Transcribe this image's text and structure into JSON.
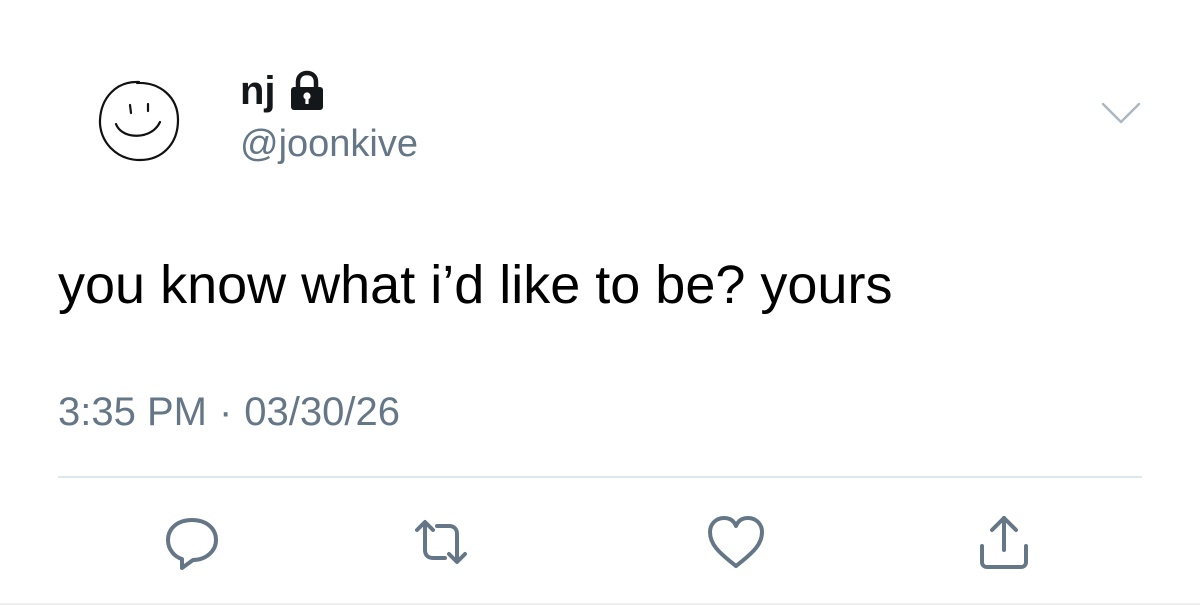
{
  "user": {
    "display_name": "nj",
    "handle": "@joonkive",
    "protected": true
  },
  "tweet": {
    "text": "you know what i’d like to be? yours",
    "time": "3:35 PM",
    "separator": "·",
    "date": "03/30/26"
  },
  "icons": {
    "avatar": "smiley-face-drawing",
    "lock": "lock-icon",
    "menu": "chevron-down-icon",
    "reply": "reply-icon",
    "retweet": "retweet-icon",
    "like": "heart-icon",
    "share": "share-icon"
  },
  "colors": {
    "text": "#000000",
    "secondary": "#657786",
    "divider": "#e1e8ed",
    "icon": "#657786"
  }
}
